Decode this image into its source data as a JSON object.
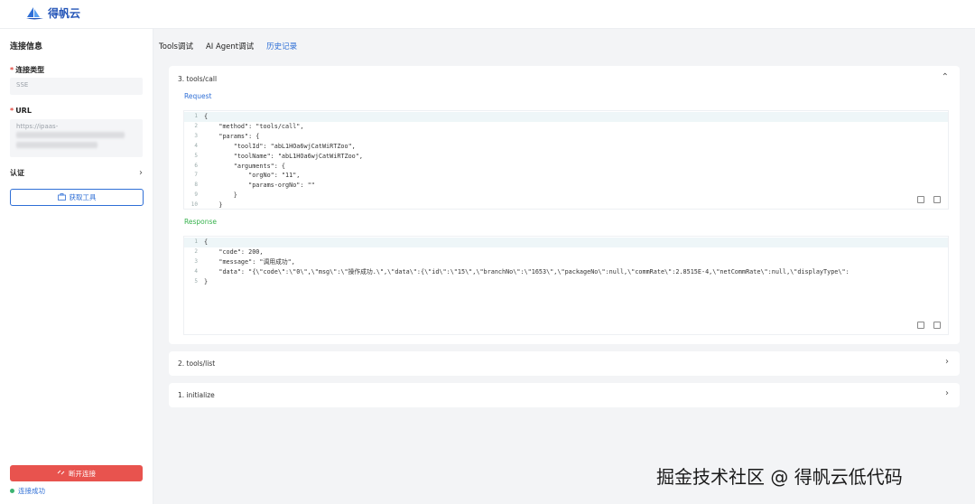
{
  "app": {
    "logo_text": "得帆云"
  },
  "sidebar": {
    "title": "连接信息",
    "connection_type_label": "连接类型",
    "connection_type_value": "SSE",
    "url_label": "URL",
    "url_value": "https://ipaas-",
    "auth_label": "认证",
    "fetch_tools_label": "获取工具",
    "disconnect_label": "断开连接",
    "status_text": "连接成功"
  },
  "tabs": [
    {
      "label": "Tools调试",
      "active": false
    },
    {
      "label": "AI Agent调试",
      "active": false
    },
    {
      "label": "历史记录",
      "active": true
    }
  ],
  "panels": {
    "p3": {
      "title": "3. tools/call",
      "request_label": "Request",
      "response_label": "Response",
      "request_lines": [
        "{",
        "    \"method\": \"tools/call\",",
        "    \"params\": {",
        "        \"toolId\": \"abL1HOa6wjCatWiRTZoo\",",
        "        \"toolName\": \"abL1HOa6wjCatWiRTZoo\",",
        "        \"arguments\": {",
        "            \"orgNo\": \"11\",",
        "            \"params-orgNo\": \"\"",
        "        }",
        "    }"
      ],
      "response_lines": [
        "{",
        "    \"code\": 200,",
        "    \"message\": \"调用成功\",",
        "    \"data\": \"{\\\"code\\\":\\\"0\\\",\\\"msg\\\":\\\"操作成功.\\\",\\\"data\\\":{\\\"id\\\":\\\"15\\\",\\\"branchNo\\\":\\\"1653\\\",\\\"packageNo\\\":null,\\\"commRate\\\":2.8515E-4,\\\"netCommRate\\\":null,\\\"displayType\\\":",
        "}"
      ]
    },
    "p2": {
      "title": "2. tools/list"
    },
    "p1": {
      "title": "1. initialize"
    }
  },
  "watermark": "掘金技术社区 @ 得帆云低代码"
}
